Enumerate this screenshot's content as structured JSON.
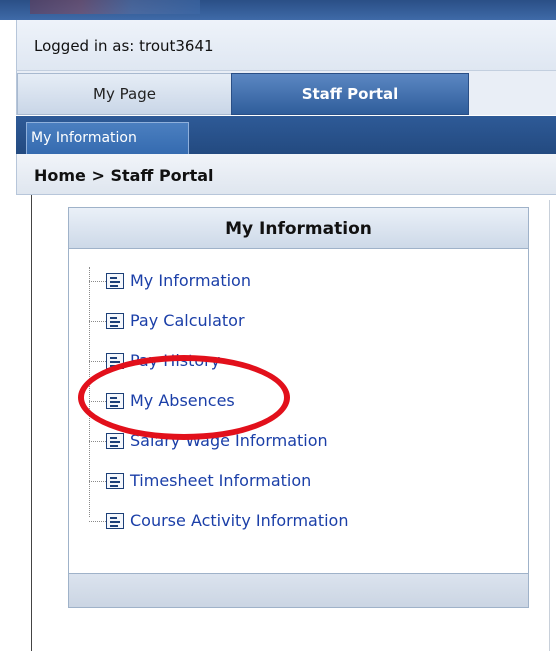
{
  "header": {
    "logged_in_text": "Logged in as: trout3641"
  },
  "tabs": [
    {
      "label": "My Page",
      "active": false
    },
    {
      "label": "Staff Portal",
      "active": true
    }
  ],
  "subnav": {
    "active_label": "My Information"
  },
  "breadcrumb": "Home > Staff Portal",
  "panel": {
    "title": "My Information",
    "items": [
      {
        "label": "My Information",
        "icon": "document-icon"
      },
      {
        "label": "Pay Calculator",
        "icon": "document-icon"
      },
      {
        "label": "Pay History",
        "icon": "document-icon"
      },
      {
        "label": "My Absences",
        "icon": "document-icon"
      },
      {
        "label": "Salary Wage Information",
        "icon": "document-icon"
      },
      {
        "label": "Timesheet Information",
        "icon": "document-icon"
      },
      {
        "label": "Course Activity Information",
        "icon": "document-icon"
      }
    ]
  },
  "highlight": {
    "target": "My Absences",
    "color": "#e2101b"
  },
  "colors": {
    "link": "#1b3fa8",
    "active_tab": "#2f5d9b",
    "subnav": "#234a80"
  }
}
